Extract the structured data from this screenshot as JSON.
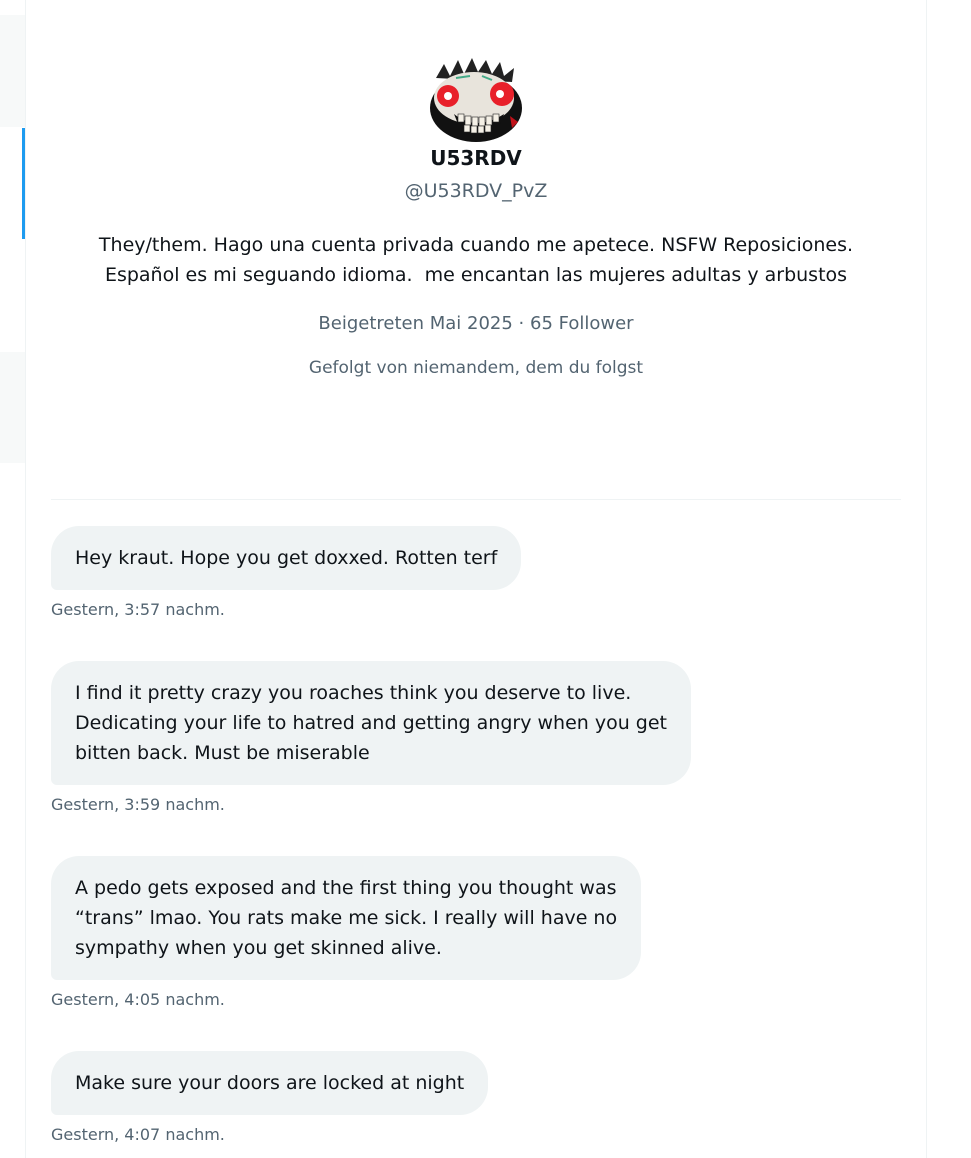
{
  "profile": {
    "display_name": "U53RDV",
    "handle": "@U53RDV_PvZ",
    "bio": "They/them. Hago una cuenta privada cuando me apetece. NSFW Reposiciones.\nEspañol es mi seguando idioma.  me encantan las mujeres adultas y arbustos",
    "joined_and_followers": "Beigetreten Mai 2025 · 65 Follower",
    "followed_by": "Gefolgt von niemandem, dem du folgst"
  },
  "messages": [
    {
      "text": "Hey kraut. Hope you get doxxed. Rotten terf",
      "time": "Gestern, 3:57 nachm."
    },
    {
      "text": "I find it pretty crazy you roaches think you deserve to live.\nDedicating your life to hatred and getting angry when you get\nbitten back. Must be miserable",
      "time": "Gestern, 3:59 nachm."
    },
    {
      "text": "A pedo gets exposed and the first thing you thought was\n“trans” lmao. You rats make me sick. I really will have no\nsympathy when you get skinned alive.",
      "time": "Gestern, 4:05 nachm."
    },
    {
      "text": "Make sure your doors are locked at night",
      "time": "Gestern, 4:07 nachm."
    }
  ],
  "colors": {
    "accent": "#1d9bf0",
    "bubble": "#eff3f4",
    "secondary_text": "#536471"
  },
  "icons": {
    "avatar": "skull-face-avatar"
  }
}
